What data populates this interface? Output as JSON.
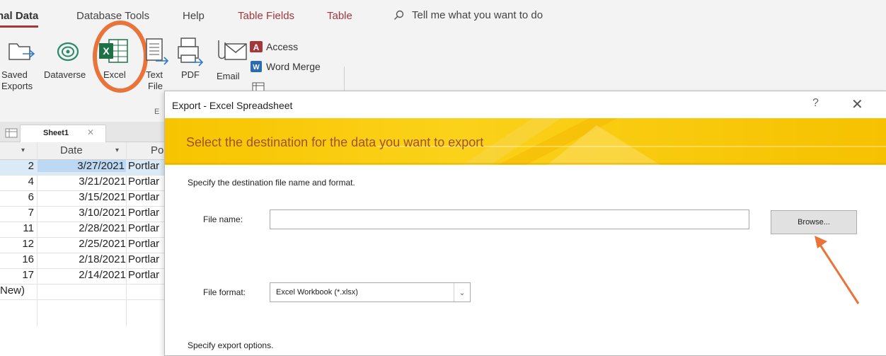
{
  "ribbon_tabs": [
    "nal Data",
    "Database Tools",
    "Help",
    "Table Fields",
    "Table"
  ],
  "tell_me": "Tell me what you want to do",
  "ribbon_buttons": {
    "saved_exports": [
      "Saved",
      "Exports"
    ],
    "dataverse": "Dataverse",
    "excel": "Excel",
    "text_file": [
      "Text",
      "File"
    ],
    "pdf": "PDF",
    "email": "Email",
    "access": "Access",
    "word_merge": "Word Merge",
    "group_label": "E"
  },
  "document_tab": "Sheet1",
  "grid": {
    "columns": [
      "Date",
      "Po"
    ],
    "rows": [
      {
        "id": "2",
        "date": "3/27/2021",
        "city": "Portlar"
      },
      {
        "id": "4",
        "date": "3/21/2021",
        "city": "Portlar"
      },
      {
        "id": "6",
        "date": "3/15/2021",
        "city": "Portlar"
      },
      {
        "id": "7",
        "date": "3/10/2021",
        "city": "Portlar"
      },
      {
        "id": "11",
        "date": "2/28/2021",
        "city": "Portlar"
      },
      {
        "id": "12",
        "date": "2/25/2021",
        "city": "Portlar"
      },
      {
        "id": "16",
        "date": "2/18/2021",
        "city": "Portlar"
      },
      {
        "id": "17",
        "date": "2/14/2021",
        "city": "Portlar"
      }
    ],
    "new_row_label": "New)"
  },
  "dialog": {
    "title": "Export - Excel Spreadsheet",
    "help": "?",
    "banner": "Select the destination for the data you want to export",
    "instruction": "Specify the destination file name and format.",
    "file_name_label": "File name:",
    "file_name_value": "",
    "browse_label": "Browse...",
    "file_format_label": "File format:",
    "file_format_value": "Excel Workbook (*.xlsx)",
    "export_options": "Specify export options."
  },
  "colors": {
    "accent": "#a4373a",
    "banner": "#f7c400",
    "annotation": "#e8743b"
  }
}
